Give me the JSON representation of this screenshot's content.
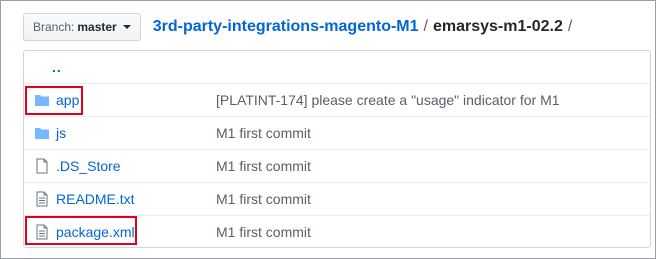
{
  "branch": {
    "prefix": "Branch:",
    "name": "master"
  },
  "breadcrumb": {
    "repo": "3rd-party-integrations-magento-M1",
    "separator": "/",
    "directory": "emarsys-m1-02.2",
    "trailing": "/"
  },
  "parent_link": "..",
  "files": [
    {
      "type": "folder",
      "icon": "folder-icon",
      "name": "app",
      "message": "[PLATINT-174] please create a \"usage\" indicator for M1"
    },
    {
      "type": "folder",
      "icon": "folder-icon",
      "name": "js",
      "message": "M1 first commit"
    },
    {
      "type": "file",
      "icon": "file-icon",
      "name": ".DS_Store",
      "message": "M1 first commit"
    },
    {
      "type": "file",
      "icon": "file-icon",
      "name": "README.txt",
      "message": "M1 first commit"
    },
    {
      "type": "file",
      "icon": "file-icon",
      "name": "package.xml",
      "message": "M1 first commit"
    }
  ],
  "colors": {
    "link": "#0366d6",
    "highlight": "#e3001b",
    "icon": "#79b8ff"
  }
}
